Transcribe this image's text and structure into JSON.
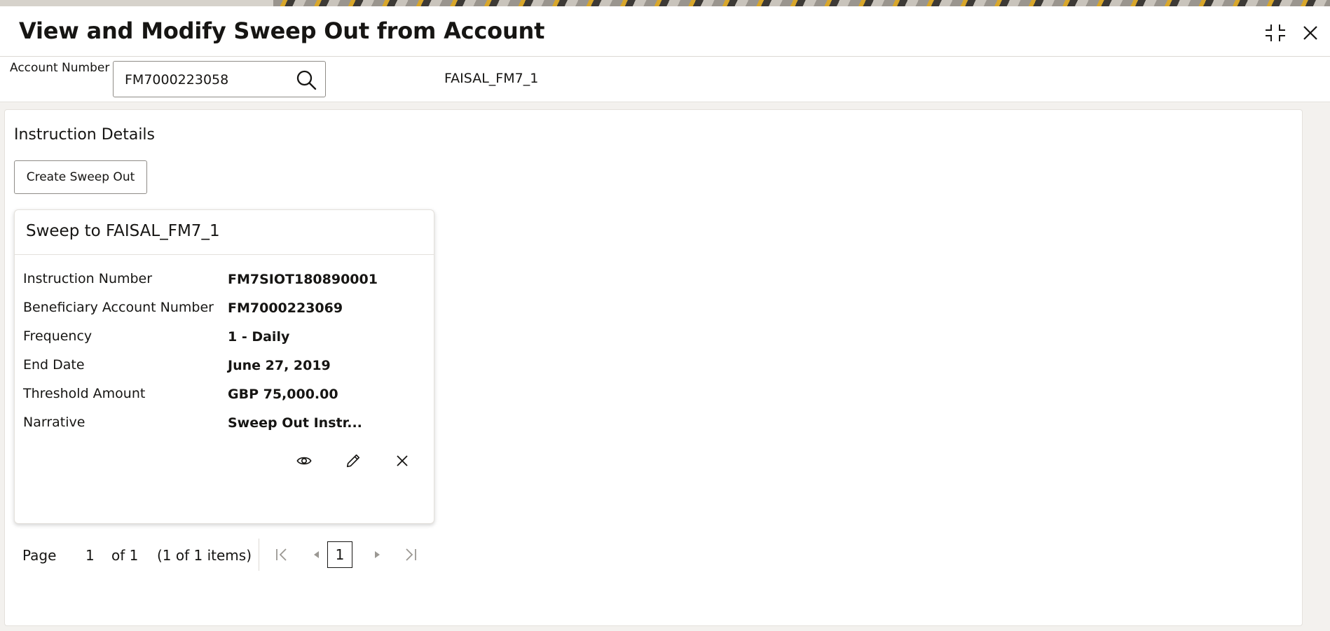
{
  "window": {
    "title": "View and Modify Sweep Out from Account"
  },
  "account": {
    "label": "Account Number",
    "value": "FM7000223058",
    "name": "FAISAL_FM7_1"
  },
  "instructions": {
    "section_title": "Instruction Details",
    "create_label": "Create Sweep Out",
    "card": {
      "title": "Sweep to FAISAL_FM7_1",
      "fields": [
        {
          "label": "Instruction Number",
          "value": "FM7SIOT180890001"
        },
        {
          "label": "Beneficiary Account Number",
          "value": "FM7000223069"
        },
        {
          "label": "Frequency",
          "value": "1 - Daily"
        },
        {
          "label": "End Date",
          "value": "June 27, 2019"
        },
        {
          "label": "Threshold Amount",
          "value": "GBP 75,000.00"
        },
        {
          "label": "Narrative",
          "value": "Sweep Out Instr..."
        }
      ]
    }
  },
  "pagination": {
    "page_label": "Page",
    "page_value": "1",
    "of_text": "of 1",
    "items_text": "(1 of 1 items)",
    "current_page": "1"
  },
  "icons": {
    "minimize": "minimize-icon",
    "close": "close-icon",
    "search": "search-icon",
    "view": "eye-icon",
    "edit": "pencil-icon",
    "delete": "close-icon",
    "first": "first-page-icon",
    "prev": "prev-page-icon",
    "next": "next-page-icon",
    "last": "last-page-icon"
  }
}
